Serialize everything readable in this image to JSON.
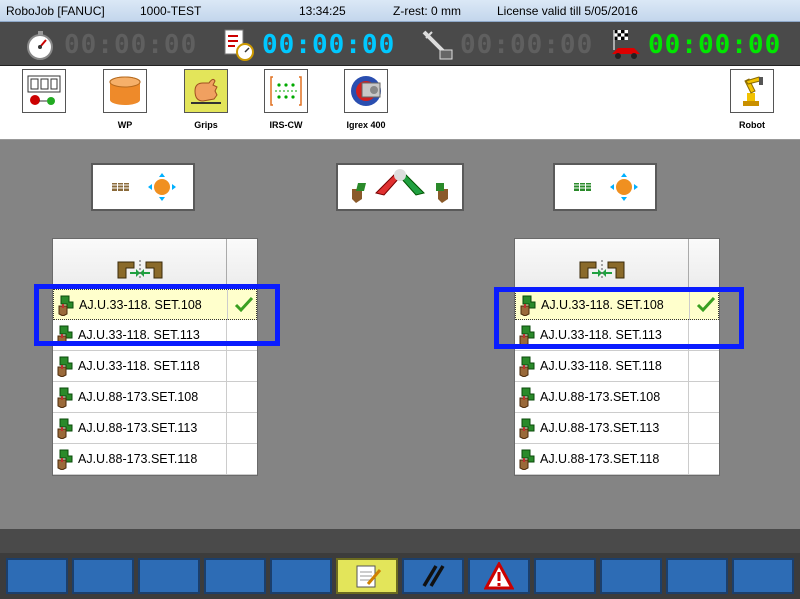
{
  "titlebar": {
    "app": "RoboJob [FANUC]",
    "job": "1000-TEST",
    "time": "13:34:25",
    "zrest": "Z-rest: 0 mm",
    "license": "License valid till 5/05/2016"
  },
  "timers": [
    {
      "icon": "stopwatch-icon",
      "value": "00:00:00",
      "color": "#5f5f5f"
    },
    {
      "icon": "checklist-stopwatch-icon",
      "value": "00:00:00",
      "color": "#00c8ff"
    },
    {
      "icon": "caliper-icon",
      "value": "00:00:00",
      "color": "#5f5f5f"
    },
    {
      "icon": "race-car-flag-icon",
      "value": "00:00:00",
      "color": "#00e600"
    }
  ],
  "toolbar": {
    "items": [
      {
        "icon": "process-flow-icon",
        "label": ""
      },
      {
        "icon": "workpiece-icon",
        "label": "WP"
      },
      {
        "icon": "grips-hand-icon",
        "label": "Grips",
        "active": true
      },
      {
        "icon": "irs-cw-icon",
        "label": "IRS-CW"
      },
      {
        "icon": "machine-icon",
        "label": "Igrex 400"
      },
      {
        "icon": "robot-arm-icon",
        "label": "Robot"
      }
    ]
  },
  "left_panel": {
    "rows": [
      {
        "label": "AJ.U.33-118. SET.108",
        "checked": true
      },
      {
        "label": "AJ.U.33-118. SET.113",
        "checked": false
      },
      {
        "label": "AJ.U.33-118. SET.118",
        "checked": false
      },
      {
        "label": "AJ.U.88-173.SET.108",
        "checked": false
      },
      {
        "label": "AJ.U.88-173.SET.113",
        "checked": false
      },
      {
        "label": "AJ.U.88-173.SET.118",
        "checked": false
      }
    ]
  },
  "right_panel": {
    "rows": [
      {
        "label": "AJ.U.33-118. SET.108",
        "checked": true
      },
      {
        "label": "AJ.U.33-118. SET.113",
        "checked": false
      },
      {
        "label": "AJ.U.33-118. SET.118",
        "checked": false
      },
      {
        "label": "AJ.U.88-173.SET.108",
        "checked": false
      },
      {
        "label": "AJ.U.88-173.SET.113",
        "checked": false
      },
      {
        "label": "AJ.U.88-173.SET.118",
        "checked": false
      }
    ]
  },
  "colors": {
    "highlight": "#0a1cff",
    "selected_row": "#ffffcc",
    "bottom_button": "#2d6cb5",
    "active_button": "#e3e55a"
  },
  "bottom_buttons": [
    {
      "icon": ""
    },
    {
      "icon": ""
    },
    {
      "icon": ""
    },
    {
      "icon": ""
    },
    {
      "icon": ""
    },
    {
      "icon": "notepad-icon",
      "active": true
    },
    {
      "icon": "pause-slash-icon"
    },
    {
      "icon": "warning-icon"
    },
    {
      "icon": ""
    },
    {
      "icon": ""
    },
    {
      "icon": ""
    },
    {
      "icon": ""
    }
  ]
}
